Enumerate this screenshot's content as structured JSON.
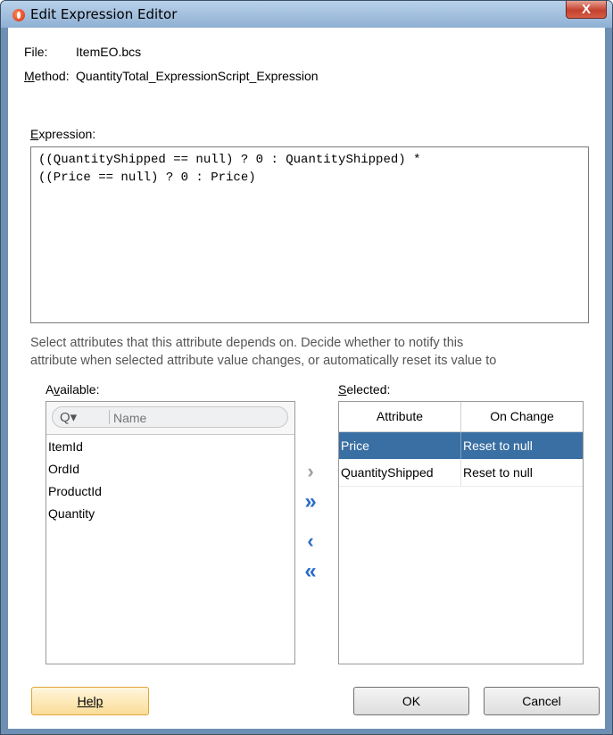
{
  "window": {
    "title": "Edit Expression Editor",
    "close_glyph": "X"
  },
  "file": {
    "label": "File:",
    "value": "ItemEO.bcs"
  },
  "method": {
    "label": "Method:",
    "value": "QuantityTotal_ExpressionScript_Expression"
  },
  "expression": {
    "label": "Expression:",
    "line1": "((QuantityShipped == null) ? 0 : QuantityShipped) *",
    "line2": "((Price == null) ? 0 : Price)"
  },
  "hint": {
    "line1": "Select attributes that this attribute depends on. Decide whether to notify this",
    "line2": "attribute when selected attribute value changes, or automatically reset its value to"
  },
  "available": {
    "label": "Available:",
    "search_placeholder": "Name",
    "items": [
      "ItemId",
      "OrdId",
      "ProductId",
      "Quantity"
    ]
  },
  "shuttle": {
    "add": "›",
    "add_all": "»",
    "remove": "‹",
    "remove_all": "«"
  },
  "selected": {
    "label": "Selected:",
    "columns": [
      "Attribute",
      "On Change"
    ],
    "rows": [
      {
        "attribute": "Price",
        "on_change": "Reset to null",
        "selected": true
      },
      {
        "attribute": "QuantityShipped",
        "on_change": "Reset to null",
        "selected": false
      }
    ]
  },
  "buttons": {
    "help": "Help",
    "ok": "OK",
    "cancel": "Cancel"
  },
  "colors": {
    "selection": "#3a6fa3",
    "help_border": "#e0a43c",
    "shuttle_active": "#2a6dc8",
    "shuttle_inactive": "#9aa0a6"
  },
  "icons": {
    "app": "oracle-app-icon",
    "search": "search-icon",
    "close": "close-icon"
  }
}
